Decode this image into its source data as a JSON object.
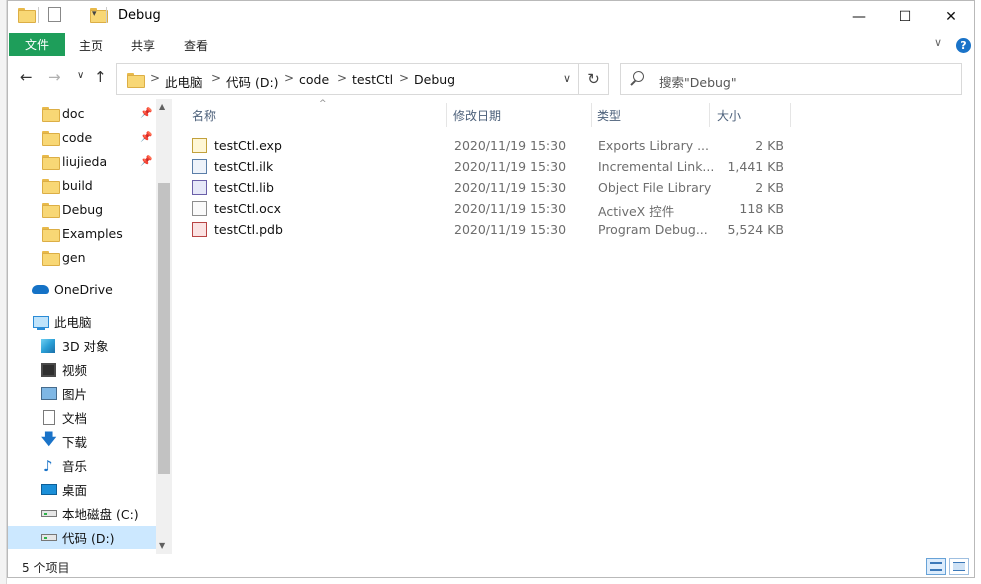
{
  "window": {
    "title": "Debug",
    "controls": {
      "minimize": "—",
      "maximize": "☐",
      "close": "✕"
    }
  },
  "ribbon": {
    "file_tab": "文件",
    "tabs": [
      "主页",
      "共享",
      "查看"
    ],
    "help": "?",
    "collapse": "∨"
  },
  "nav": {
    "back": "←",
    "forward": "→",
    "recent": "∨",
    "up": "↑",
    "refresh": "↻",
    "dropdown": "∨",
    "breadcrumbs": [
      "此电脑",
      "代码 (D:)",
      "code",
      "testCtl",
      "Debug"
    ],
    "separator": ">",
    "search_placeholder": "搜索\"Debug\""
  },
  "sidebar": {
    "quick_access": [
      {
        "label": "doc",
        "pinned": true
      },
      {
        "label": "code",
        "pinned": true
      },
      {
        "label": "liujieda",
        "pinned": true
      },
      {
        "label": "build",
        "pinned": false
      },
      {
        "label": "Debug",
        "pinned": false
      },
      {
        "label": "Examples",
        "pinned": false
      },
      {
        "label": "gen",
        "pinned": false
      }
    ],
    "onedrive": "OneDrive",
    "this_pc": "此电脑",
    "pc_items": [
      {
        "label": "3D 对象",
        "icon": "3d-objects-icon"
      },
      {
        "label": "视频",
        "icon": "video-icon"
      },
      {
        "label": "图片",
        "icon": "pictures-icon"
      },
      {
        "label": "文档",
        "icon": "documents-icon"
      },
      {
        "label": "下载",
        "icon": "downloads-icon"
      },
      {
        "label": "音乐",
        "icon": "music-icon"
      },
      {
        "label": "桌面",
        "icon": "desktop-icon"
      },
      {
        "label": "本地磁盘 (C:)",
        "icon": "drive-icon"
      },
      {
        "label": "代码 (D:)",
        "icon": "drive-icon"
      }
    ],
    "selected": "代码 (D:)"
  },
  "columns": {
    "name": "名称",
    "modified": "修改日期",
    "type": "类型",
    "size": "大小"
  },
  "files": [
    {
      "name": "testCtl.exp",
      "modified": "2020/11/19 15:30",
      "type": "Exports Library ...",
      "size": "2 KB",
      "icon": "exp-file-icon"
    },
    {
      "name": "testCtl.ilk",
      "modified": "2020/11/19 15:30",
      "type": "Incremental Link...",
      "size": "1,441 KB",
      "icon": "ilk-file-icon"
    },
    {
      "name": "testCtl.lib",
      "modified": "2020/11/19 15:30",
      "type": "Object File Library",
      "size": "2 KB",
      "icon": "lib-file-icon"
    },
    {
      "name": "testCtl.ocx",
      "modified": "2020/11/19 15:30",
      "type": "ActiveX 控件",
      "size": "118 KB",
      "icon": "ocx-file-icon"
    },
    {
      "name": "testCtl.pdb",
      "modified": "2020/11/19 15:30",
      "type": "Program Debug...",
      "size": "5,524 KB",
      "icon": "pdb-file-icon"
    }
  ],
  "status": {
    "item_count": "5 个项目"
  },
  "colors": {
    "file_tab": "#1e9e5a",
    "selection": "#cce8ff",
    "folder": "#f8d775"
  }
}
